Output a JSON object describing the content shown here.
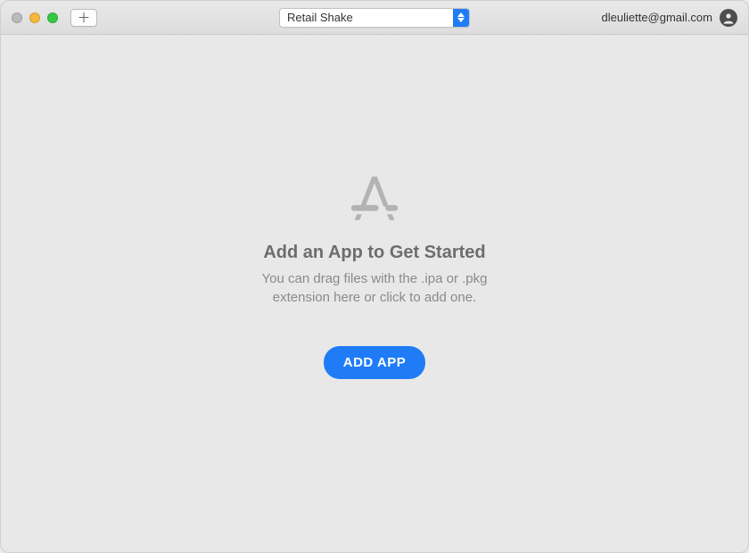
{
  "titlebar": {
    "add_tab_glyph": "＋",
    "dropdown_selected": "Retail Shake"
  },
  "account": {
    "email": "dleuliette@gmail.com"
  },
  "empty_state": {
    "heading": "Add an App to Get Started",
    "subtext": "You can drag files with the .ipa or .pkg extension here or click to add one.",
    "button_label": "ADD APP"
  }
}
